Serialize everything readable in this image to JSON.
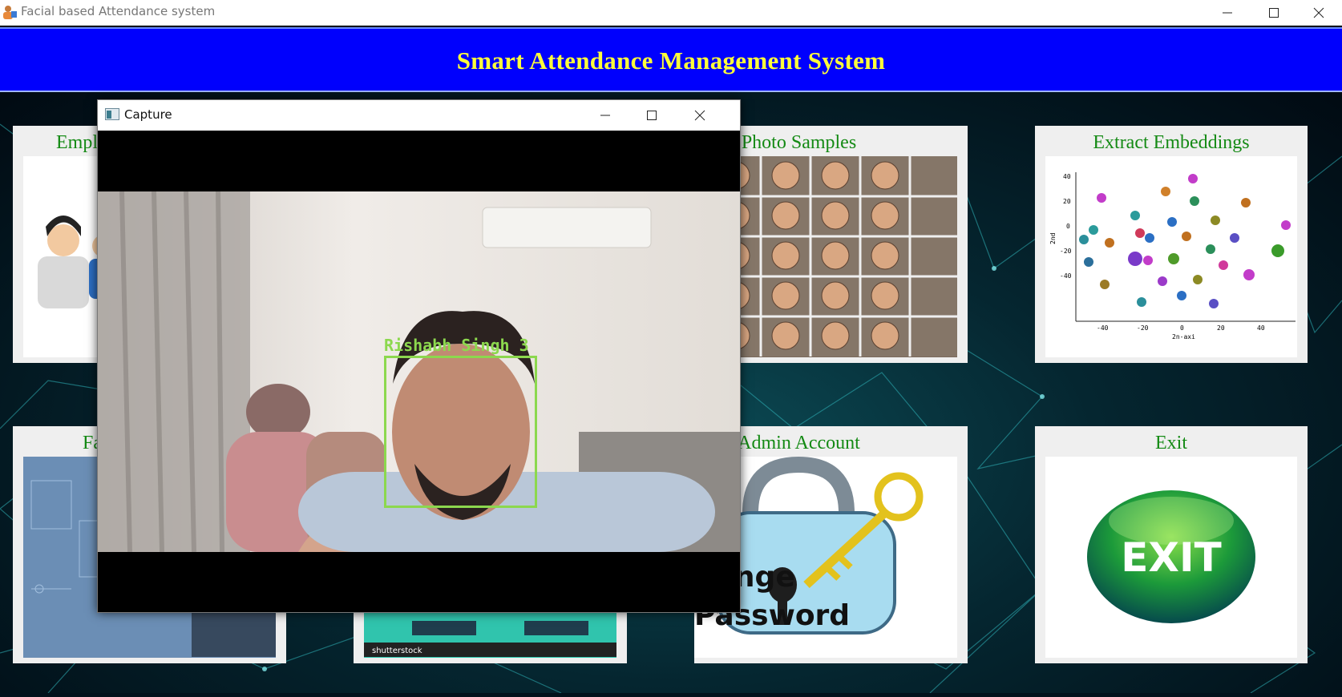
{
  "window": {
    "title": "Facial based Attendance system",
    "controls": [
      "minimize-icon",
      "maximize-icon",
      "close-icon"
    ]
  },
  "header": {
    "title": "Smart Attendance Management System",
    "bg_color": "#0000fd",
    "text_color": "#ffff3a"
  },
  "tiles": [
    {
      "label": "Empl",
      "image": "employees-icon"
    },
    {
      "label": "Photo Samples",
      "image": "face-grid-photo"
    },
    {
      "label": "Extract Embeddings",
      "image": "scatter-plot"
    },
    {
      "label": "Fa",
      "image": "face-scan-photo"
    },
    {
      "label": "",
      "image": "shutterstock-photo"
    },
    {
      "label": "Admin Account",
      "image": "padlock-key-icon"
    },
    {
      "label": "Exit",
      "image": "exit-button-icon"
    }
  ],
  "embedding_plot": {
    "y_ticks": [
      "40",
      "20",
      "0",
      "-20",
      "-40"
    ],
    "x_ticks": [
      "-40",
      "-20",
      "0",
      "20",
      "40"
    ],
    "y_axis_label": "2nd",
    "x_axis_label": "2n-axi"
  },
  "admin_image_text": {
    "line1": "hange",
    "line2": "Password"
  },
  "exit_image_text": "EXIT",
  "shutterstock_text": "shutterstock",
  "capture_window": {
    "title": "Capture",
    "face_label": "Rishabh Singh 3",
    "box_color": "#8cd84e"
  },
  "label_color": "#148a14"
}
